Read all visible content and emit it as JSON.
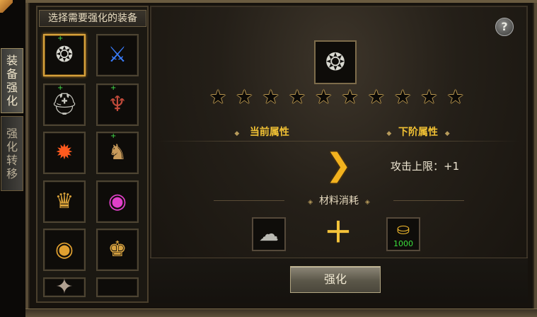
{
  "side_tabs": [
    {
      "label": "装\n备\n强\n化",
      "chars": [
        "装",
        "备",
        "强",
        "化"
      ],
      "active": true
    },
    {
      "label": "强\n化\n转\n移",
      "chars": [
        "强",
        "化",
        "转",
        "移"
      ],
      "active": false
    }
  ],
  "equipment_panel": {
    "header": "选择需要强化的装备",
    "items": [
      {
        "icon": "gem-ring-icon",
        "glyph": "❂",
        "color": "#d8d8d0",
        "plus": true,
        "selected": true
      },
      {
        "icon": "sword-icon",
        "glyph": "⚔",
        "color": "#3a7dff",
        "plus": false,
        "selected": false
      },
      {
        "icon": "silver-helmet-icon",
        "glyph": "⛑",
        "color": "#c8c8c0",
        "plus": true,
        "selected": false
      },
      {
        "icon": "horned-helmet-icon",
        "glyph": "♆",
        "color": "#c04a3a",
        "plus": true,
        "selected": false
      },
      {
        "icon": "flame-armor-icon",
        "glyph": "✹",
        "color": "#ff5a1e",
        "plus": false,
        "selected": false
      },
      {
        "icon": "boots-icon",
        "glyph": "♞",
        "color": "#c89a5a",
        "plus": true,
        "selected": false
      },
      {
        "icon": "gold-bracelet-icon",
        "glyph": "♛",
        "color": "#d9a23a",
        "plus": false,
        "selected": false
      },
      {
        "icon": "ruby-ring-icon",
        "glyph": "◉",
        "color": "#e040c8",
        "plus": false,
        "selected": false
      },
      {
        "icon": "gem-ring-icon",
        "glyph": "◉",
        "color": "#e0a030",
        "plus": false,
        "selected": false
      },
      {
        "icon": "gold-belt-icon",
        "glyph": "♚",
        "color": "#d4a040",
        "plus": false,
        "selected": false
      },
      {
        "icon": "partial-item-icon",
        "glyph": "✦",
        "color": "#b0a090",
        "plus": false,
        "selected": false
      },
      {
        "icon": "",
        "glyph": "",
        "color": "#000",
        "plus": false,
        "selected": false
      }
    ]
  },
  "target": {
    "icon": "gem-ring-icon",
    "glyph": "❂"
  },
  "stars_total": 10,
  "stars_filled": 0,
  "current_attr_label": "当前属性",
  "next_attr_label": "下阶属性",
  "next_attr_value": "攻击上限：+1",
  "materials": {
    "title": "材料消耗",
    "item1_icon": "ore-icon",
    "item2_icon": "gold-ingot-icon",
    "gold_count": "1000"
  },
  "help_label": "?",
  "enhance_button": "强化"
}
